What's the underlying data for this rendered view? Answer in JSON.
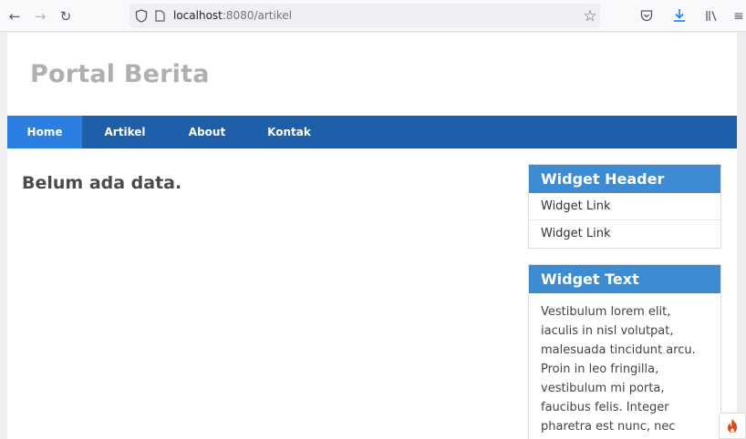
{
  "browser": {
    "url_host": "localhost",
    "url_rest": ":8080/artikel"
  },
  "site": {
    "title": "Portal Berita"
  },
  "nav": {
    "items": [
      "Home",
      "Artikel",
      "About",
      "Kontak"
    ]
  },
  "main": {
    "message": "Belum ada data."
  },
  "sidebar": {
    "widget_links": {
      "header": "Widget Header",
      "links": [
        "Widget Link",
        "Widget Link"
      ]
    },
    "widget_text": {
      "header": "Widget Text",
      "body": "Vestibulum lorem elit, iaculis in nisl volutpat, malesuada tincidunt arcu. Proin in leo fringilla, vestibulum mi porta, faucibus felis. Integer pharetra est nunc, nec pretium nunc pretium ac."
    }
  },
  "colors": {
    "nav_bg": "#1f5faa",
    "nav_active": "#2b7fe0",
    "widget_header": "#3d8bd0"
  }
}
